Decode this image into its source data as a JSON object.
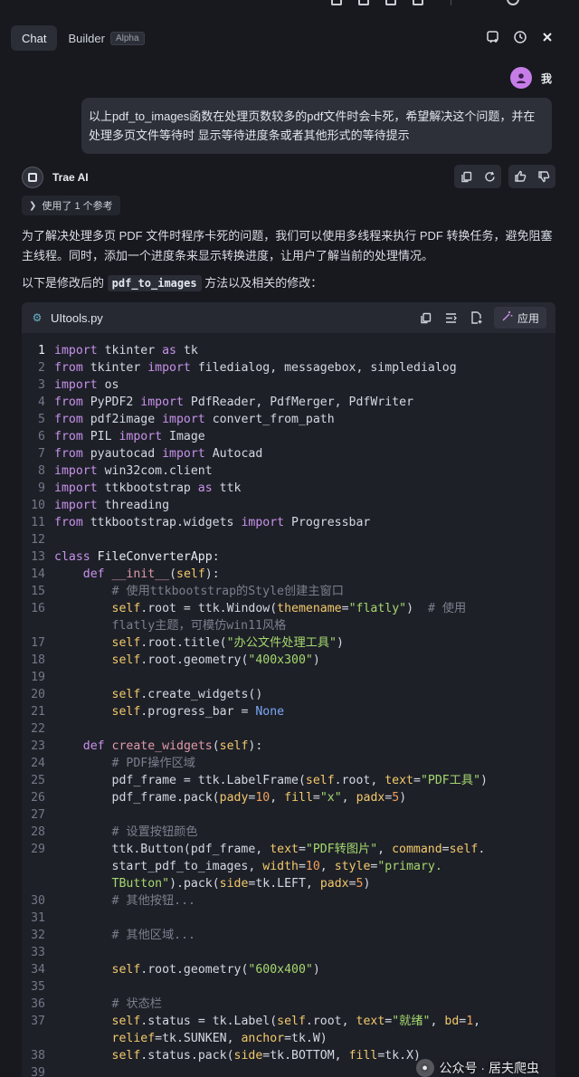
{
  "tabs": [
    {
      "label": "Chat",
      "active": true
    },
    {
      "label": "Builder",
      "badge": "Alpha",
      "active": false
    }
  ],
  "user": {
    "name": "我"
  },
  "user_message": "以上pdf_to_images函数在处理页数较多的pdf文件时会卡死，希望解决这个问题，并在处理多页文件等待时 显示等待进度条或者其他形式的等待提示",
  "assistant": {
    "name": "Trae AI",
    "refs_label": "使用了 1 个参考",
    "paragraph1": "为了解决处理多页 PDF 文件时程序卡死的问题，我们可以使用多线程来执行 PDF 转换任务，避免阻塞主线程。同时，添加一个进度条来显示转换进度，让用户了解当前的处理情况。",
    "paragraph2_before": "以下是修改后的",
    "paragraph2_code": "pdf_to_images",
    "paragraph2_after": "方法以及相关的修改："
  },
  "code_block": {
    "filename": "UItools.py",
    "apply_label": "应用"
  },
  "watermark": "公众号 · 居夫爬虫",
  "colors": {
    "avatar": "#c77de8",
    "keyword": "#c792ea",
    "string": "#a5d86e",
    "self": "#f2c96a"
  }
}
